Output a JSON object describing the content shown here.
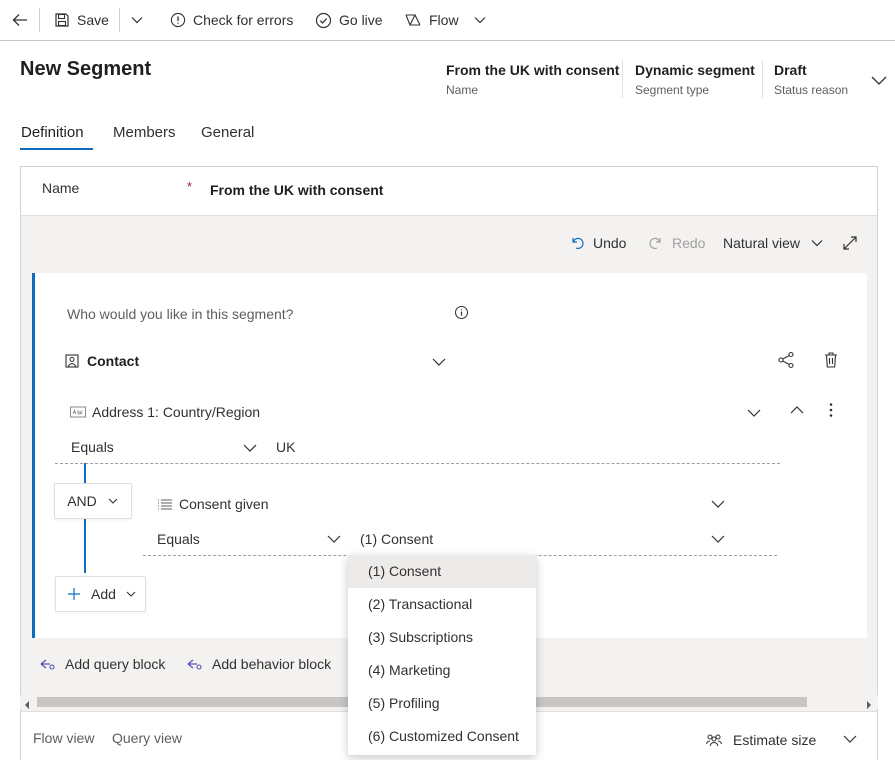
{
  "toolbar": {
    "save_label": "Save",
    "check_label": "Check for errors",
    "golive_label": "Go live",
    "flow_label": "Flow"
  },
  "header": {
    "title": "New Segment",
    "fields": [
      {
        "value": "From the UK with consent",
        "label": "Name"
      },
      {
        "value": "Dynamic segment",
        "label": "Segment type"
      },
      {
        "value": "Draft",
        "label": "Status reason"
      }
    ]
  },
  "tabs": [
    {
      "label": "Definition"
    },
    {
      "label": "Members"
    },
    {
      "label": "General"
    }
  ],
  "name_field": {
    "label": "Name",
    "required_mark": "*",
    "value": "From the UK with consent"
  },
  "view_controls": {
    "undo_label": "Undo",
    "redo_label": "Redo",
    "view_label": "Natural view"
  },
  "builder": {
    "prompt": "Who would you like in this segment?",
    "entity": "Contact",
    "condition1": {
      "attribute": "Address 1: Country/Region",
      "operator": "Equals",
      "value": "UK"
    },
    "logic": "AND",
    "condition2": {
      "attribute": "Consent given",
      "operator": "Equals",
      "value": "(1) Consent"
    },
    "add_label": "Add"
  },
  "blocks": {
    "add_query_label": "Add query block",
    "add_behavior_label": "Add behavior block"
  },
  "bottom": {
    "flow_view_label": "Flow view",
    "query_view_label": "Query view",
    "estimate_label": "Estimate size"
  },
  "dropdown": {
    "options": [
      "(1) Consent",
      "(2) Transactional",
      "(3) Subscriptions",
      "(4) Marketing",
      "(5) Profiling",
      "(6) Customized Consent"
    ],
    "selected_index": 0
  },
  "colors": {
    "accent": "#0f6cbd",
    "required": "#a4262c",
    "gray_bg": "#f3f2f1"
  }
}
